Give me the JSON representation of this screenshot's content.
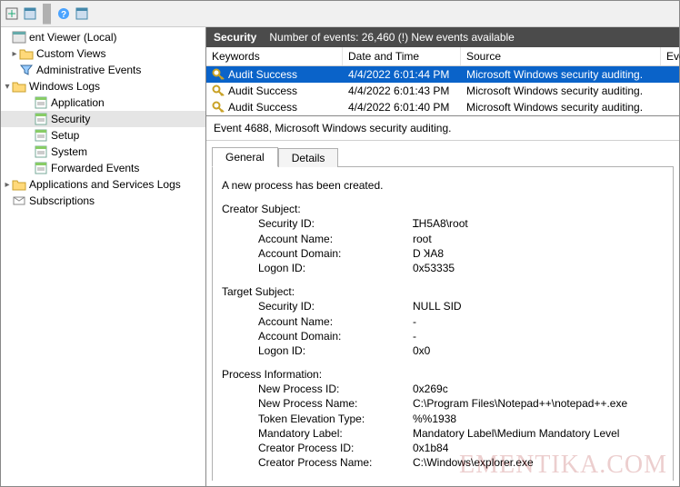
{
  "watermark": "EMENTIKA.COM",
  "tree": [
    {
      "level": 0,
      "label": "ent Viewer (Local)",
      "twisty": "",
      "icon": "eventviewer",
      "name": "tree-root"
    },
    {
      "level": 1,
      "label": "Custom Views",
      "twisty": "▸",
      "icon": "folder",
      "name": "tree-custom-views"
    },
    {
      "level": 1,
      "label": "Administrative Events",
      "twisty": "",
      "icon": "filter",
      "name": "tree-admin-events"
    },
    {
      "level": 0,
      "label": "Windows Logs",
      "twisty": "▾",
      "icon": "folder",
      "name": "tree-windows-logs"
    },
    {
      "level": 2,
      "label": "Application",
      "twisty": "",
      "icon": "log",
      "name": "tree-application"
    },
    {
      "level": 2,
      "label": "Security",
      "twisty": "",
      "icon": "log",
      "name": "tree-security",
      "selected": true
    },
    {
      "level": 2,
      "label": "Setup",
      "twisty": "",
      "icon": "log",
      "name": "tree-setup"
    },
    {
      "level": 2,
      "label": "System",
      "twisty": "",
      "icon": "log",
      "name": "tree-system"
    },
    {
      "level": 2,
      "label": "Forwarded Events",
      "twisty": "",
      "icon": "log",
      "name": "tree-forwarded"
    },
    {
      "level": 0,
      "label": "Applications and Services Logs",
      "twisty": "▸",
      "icon": "folder",
      "name": "tree-app-services"
    },
    {
      "level": 0,
      "label": "Subscriptions",
      "twisty": "",
      "icon": "sub",
      "name": "tree-subscriptions"
    }
  ],
  "header": {
    "title": "Security",
    "subtitle": "Number of events: 26,460 (!) New events available"
  },
  "grid": {
    "columns": [
      "Keywords",
      "Date and Time",
      "Source",
      "Eve"
    ],
    "rows": [
      {
        "keywords": "Audit Success",
        "datetime": "4/4/2022 6:01:44 PM",
        "source": "Microsoft Windows security auditing.",
        "selected": true
      },
      {
        "keywords": "Audit Success",
        "datetime": "4/4/2022 6:01:43 PM",
        "source": "Microsoft Windows security auditing."
      },
      {
        "keywords": "Audit Success",
        "datetime": "4/4/2022 6:01:40 PM",
        "source": "Microsoft Windows security auditing."
      }
    ]
  },
  "detail": {
    "title": "Event 4688, Microsoft Windows security auditing.",
    "tabs": [
      "General",
      "Details"
    ],
    "lead": "A new process has been created.",
    "sections": [
      {
        "header": "Creator Subject:",
        "items": [
          {
            "k": "Security ID:",
            "v": "ꞮH5A8\\root"
          },
          {
            "k": "Account Name:",
            "v": "root"
          },
          {
            "k": "Account Domain:",
            "v": "D            ꞰA8"
          },
          {
            "k": "Logon ID:",
            "v": "0x53335"
          }
        ]
      },
      {
        "header": "Target Subject:",
        "items": [
          {
            "k": "Security ID:",
            "v": "NULL SID"
          },
          {
            "k": "Account Name:",
            "v": "-"
          },
          {
            "k": "Account Domain:",
            "v": "-"
          },
          {
            "k": "Logon ID:",
            "v": "0x0"
          }
        ]
      },
      {
        "header": "Process Information:",
        "items": [
          {
            "k": "New Process ID:",
            "v": "0x269c"
          },
          {
            "k": "New Process Name:",
            "v": "C:\\Program Files\\Notepad++\\notepad++.exe"
          },
          {
            "k": "Token Elevation Type:",
            "v": "%%1938"
          },
          {
            "k": "Mandatory Label:",
            "v": "Mandatory Label\\Medium Mandatory Level"
          },
          {
            "k": "Creator Process ID:",
            "v": "0x1b84"
          },
          {
            "k": "Creator Process Name:",
            "v": "C:\\Windows\\explorer.exe"
          }
        ]
      }
    ]
  }
}
